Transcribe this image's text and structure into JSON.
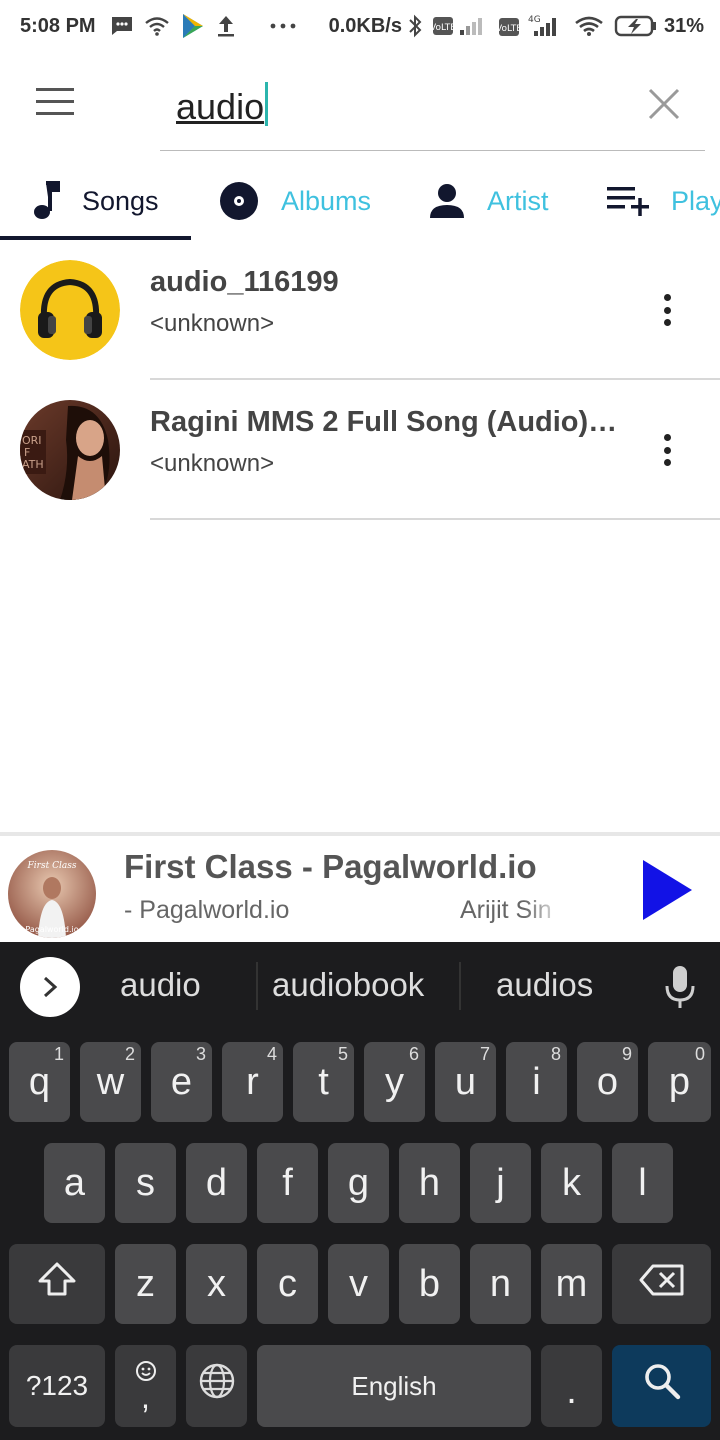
{
  "status_bar": {
    "time": "5:08 PM",
    "network_speed": "0.0KB/s",
    "battery": "31%",
    "icons": [
      "message-icon",
      "wifi-icon",
      "play-store-icon",
      "upload-icon",
      "more-dots-icon",
      "bluetooth-icon",
      "volte-signal-icon",
      "4g-signal-icon",
      "wifi-icon",
      "battery-icon"
    ]
  },
  "search": {
    "value": "audio",
    "menu_icon": "menu-icon",
    "clear_icon": "close-icon"
  },
  "tabs": [
    {
      "label": "Songs",
      "icon": "music-note-icon",
      "active": true
    },
    {
      "label": "Albums",
      "icon": "album-disc-icon",
      "active": false
    },
    {
      "label": "Artist",
      "icon": "person-icon",
      "active": false
    },
    {
      "label": "Play",
      "icon": "playlist-add-icon",
      "active": false
    }
  ],
  "songs": [
    {
      "title": "audio_116199",
      "artist": "<unknown>",
      "thumb": "headphones"
    },
    {
      "title": "Ragini MMS 2 Full Song (Audio)…",
      "artist": "<unknown>",
      "thumb": "album-art"
    }
  ],
  "now_playing": {
    "title": "First Class - Pagalworld.io",
    "subtitle_left": "- Pagalworld.io",
    "subtitle_right": "Arijit Sin",
    "thumb_text": "First Class",
    "thumb_footer": "Pagalworld.io",
    "play_color": "#1212e6"
  },
  "keyboard": {
    "suggestions": [
      "audio",
      "audiobook",
      "audios"
    ],
    "row1": [
      {
        "k": "q",
        "h": "1"
      },
      {
        "k": "w",
        "h": "2"
      },
      {
        "k": "e",
        "h": "3"
      },
      {
        "k": "r",
        "h": "4"
      },
      {
        "k": "t",
        "h": "5"
      },
      {
        "k": "y",
        "h": "6"
      },
      {
        "k": "u",
        "h": "7"
      },
      {
        "k": "i",
        "h": "8"
      },
      {
        "k": "o",
        "h": "9"
      },
      {
        "k": "p",
        "h": "0"
      }
    ],
    "row2": [
      "a",
      "s",
      "d",
      "f",
      "g",
      "h",
      "j",
      "k",
      "l"
    ],
    "row3": [
      "z",
      "x",
      "c",
      "v",
      "b",
      "n",
      "m"
    ],
    "symbols_key": "?123",
    "comma_key": ",",
    "space_key": "English",
    "period_key": "."
  },
  "colors": {
    "accent_cyan": "#3fc1df",
    "active_tab": "#12172e",
    "keyboard_bg": "#1c1c1e",
    "key_bg": "#4a4a4c",
    "search_key": "#0d3a5c"
  }
}
